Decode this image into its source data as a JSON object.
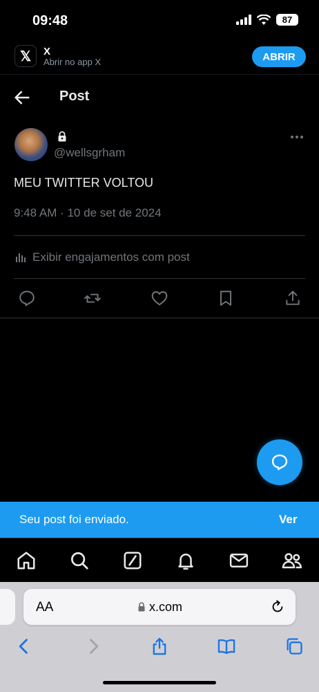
{
  "status_bar": {
    "time": "09:48",
    "battery": "87"
  },
  "app_banner": {
    "app_name": "X",
    "subtitle": "Abrir no app X",
    "open_label": "ABRIR"
  },
  "header": {
    "title": "Post"
  },
  "post": {
    "handle": "@wellsgrham",
    "text": "MEU TWITTER VOLTOU",
    "timestamp": "9:48 AM · 10 de set de 2024",
    "engagements_label": "Exibir engajamentos com post"
  },
  "toast": {
    "message": "Seu post foi enviado.",
    "action": "Ver"
  },
  "safari": {
    "aa_label": "AA",
    "url": "x.com"
  },
  "colors": {
    "accent": "#1d9bf0",
    "muted": "#71767b",
    "text": "#e7e9ea",
    "background": "#000000"
  }
}
